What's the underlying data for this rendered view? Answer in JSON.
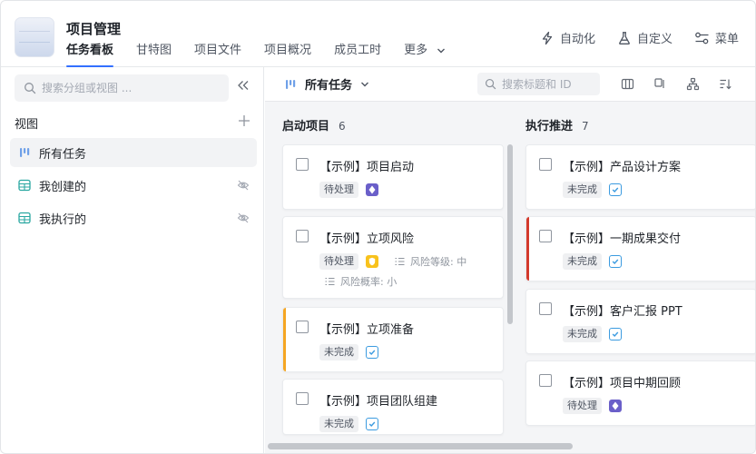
{
  "app": {
    "title": "项目管理"
  },
  "tabs": [
    {
      "label": "任务看板"
    },
    {
      "label": "甘特图"
    },
    {
      "label": "项目文件"
    },
    {
      "label": "项目概况"
    },
    {
      "label": "成员工时"
    },
    {
      "label": "更多"
    }
  ],
  "actions": {
    "automation": "自动化",
    "customize": "自定义",
    "menu": "菜单"
  },
  "sidebar": {
    "search_placeholder": "搜索分组或视图 ...",
    "views_label": "视图",
    "views": [
      {
        "label": "所有任务",
        "icon": "board-icon"
      },
      {
        "label": "我创建的",
        "icon": "table-icon"
      },
      {
        "label": "我执行的",
        "icon": "table-icon"
      }
    ]
  },
  "board": {
    "view_name": "所有任务",
    "search_placeholder": "搜索标题和 ID",
    "columns": [
      {
        "title": "启动项目",
        "count": "6",
        "cards": [
          {
            "title": "【示例】项目启动",
            "status": "待处理",
            "priority_icon": "diamond-icon"
          },
          {
            "title": "【示例】立项风险",
            "status": "待处理",
            "priority_icon": "shield-icon",
            "meta1": "风险等级: 中",
            "meta2": "风险概率: 小"
          },
          {
            "title": "【示例】立项准备",
            "status": "未完成",
            "priority_icon": "checkbox-icon",
            "accent": "#f5a623"
          },
          {
            "title": "【示例】项目团队组建",
            "status": "未完成",
            "priority_icon": "checkbox-icon"
          }
        ]
      },
      {
        "title": "执行推进",
        "count": "7",
        "cards": [
          {
            "title": "【示例】产品设计方案",
            "status": "未完成",
            "priority_icon": "checkbox-icon"
          },
          {
            "title": "【示例】一期成果交付",
            "status": "未完成",
            "priority_icon": "checkbox-icon",
            "accent": "#d33a2c"
          },
          {
            "title": "【示例】客户汇报 PPT",
            "status": "未完成",
            "priority_icon": "checkbox-icon"
          },
          {
            "title": "【示例】项目中期回顾",
            "status": "待处理",
            "priority_icon": "diamond-icon"
          }
        ]
      }
    ]
  },
  "colors": {
    "accent": "#3370ff",
    "orange": "#f5a623",
    "red": "#d33a2c",
    "purple": "#6a5fc9",
    "yellow": "#f8c21c",
    "teal": "#2aa7a1"
  }
}
